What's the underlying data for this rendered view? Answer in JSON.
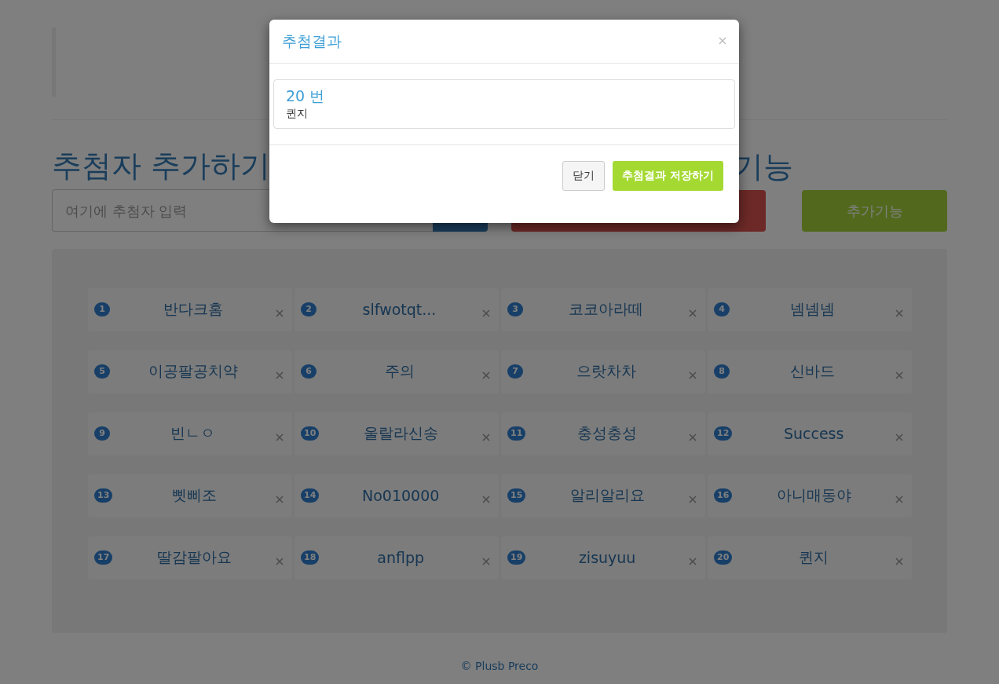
{
  "page": {
    "heading": "추첨자 추가하기",
    "heading_2": "기능",
    "input": {
      "placeholder": "여기에 추첨자 입력"
    },
    "extra_button": "추가기능"
  },
  "entries": [
    {
      "number": "1",
      "name": "반다크홈"
    },
    {
      "number": "2",
      "name": "slfwotqt..."
    },
    {
      "number": "3",
      "name": "코코아라떼"
    },
    {
      "number": "4",
      "name": "넴넴넴"
    },
    {
      "number": "5",
      "name": "이공팔공치약"
    },
    {
      "number": "6",
      "name": "주의"
    },
    {
      "number": "7",
      "name": "으랏차차"
    },
    {
      "number": "8",
      "name": "신바드"
    },
    {
      "number": "9",
      "name": "빈ㄴㅇ"
    },
    {
      "number": "10",
      "name": "울랄라신송"
    },
    {
      "number": "11",
      "name": "충성충성"
    },
    {
      "number": "12",
      "name": "Success"
    },
    {
      "number": "13",
      "name": "삣삐조"
    },
    {
      "number": "14",
      "name": "No010000"
    },
    {
      "number": "15",
      "name": "알리알리요"
    },
    {
      "number": "16",
      "name": "아니매동야"
    },
    {
      "number": "17",
      "name": "딸감팔아요"
    },
    {
      "number": "18",
      "name": "anflpp"
    },
    {
      "number": "19",
      "name": "zisuyuu"
    },
    {
      "number": "20",
      "name": "퀸지"
    }
  ],
  "footer": "© Plusb Preco",
  "modal": {
    "title": "추첨결과",
    "result_number": "20 번",
    "result_name": "퀸지",
    "buttons": [
      {
        "label": "닫기",
        "kind": "default"
      },
      {
        "label": "추첨결과 저장하기",
        "kind": "primary"
      }
    ]
  }
}
